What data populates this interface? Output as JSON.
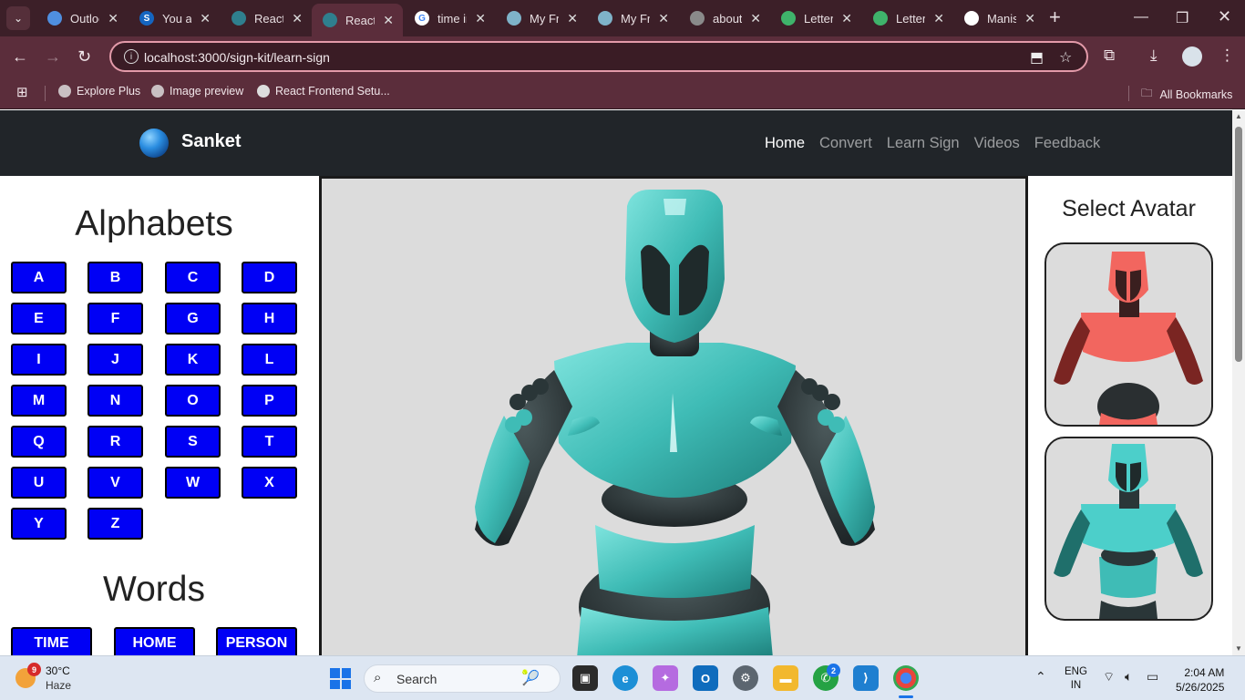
{
  "browser": {
    "tabs": [
      {
        "title": "Outlook",
        "favicon_color": "#4f8fe0",
        "active": false
      },
      {
        "title": "You are",
        "favicon_color": "#1565c0",
        "favicon_letter": "S",
        "active": false
      },
      {
        "title": "React",
        "favicon_color": "#2f7f8e",
        "active": false
      },
      {
        "title": "React",
        "favicon_color": "#2f7f8e",
        "active": true
      },
      {
        "title": "time in",
        "favicon_color": "#ffffff",
        "favicon_letter": "G",
        "active": false
      },
      {
        "title": "My Fr",
        "favicon_color": "#7fb3c9",
        "active": false
      },
      {
        "title": "My Fr",
        "favicon_color": "#7fb3c9",
        "active": false
      },
      {
        "title": "about",
        "favicon_color": "#8a8a8a",
        "active": false
      },
      {
        "title": "Letter",
        "favicon_color": "#3fb36b",
        "active": false
      },
      {
        "title": "Letter",
        "favicon_color": "#3fb36b",
        "active": false
      },
      {
        "title": "Manis",
        "favicon_color": "#ffffff",
        "active": false
      }
    ],
    "new_tab_label": "+",
    "url": "localhost:3000/sign-kit/learn-sign",
    "bookmarks": [
      "Explore Plus",
      "Image preview",
      "React Frontend Setu..."
    ],
    "all_bookmarks_label": "All Bookmarks"
  },
  "site": {
    "brand": "Sanket",
    "nav": [
      "Home",
      "Convert",
      "Learn Sign",
      "Videos",
      "Feedback"
    ],
    "active_nav": "Home"
  },
  "learn": {
    "alphabets_title": "Alphabets",
    "letters": [
      "A",
      "B",
      "C",
      "D",
      "E",
      "F",
      "G",
      "H",
      "I",
      "J",
      "K",
      "L",
      "M",
      "N",
      "O",
      "P",
      "Q",
      "R",
      "S",
      "T",
      "U",
      "V",
      "W",
      "X",
      "Y",
      "Z"
    ],
    "words_title": "Words",
    "words": [
      "TIME",
      "HOME",
      "PERSON"
    ],
    "button_color": "#0000f5"
  },
  "avatar_panel": {
    "title": "Select Avatar",
    "avatars": [
      {
        "name": "red robot",
        "body_color": "#f2665f"
      },
      {
        "name": "teal robot",
        "body_color": "#4ccfca"
      }
    ]
  },
  "taskbar": {
    "weather_temp": "30°C",
    "weather_cond": "Haze",
    "notification_count": "9",
    "search_placeholder": "Search",
    "whatsapp_badge": "2",
    "lang_line1": "ENG",
    "lang_line2": "IN",
    "time": "2:04 AM",
    "date": "5/26/2025"
  }
}
